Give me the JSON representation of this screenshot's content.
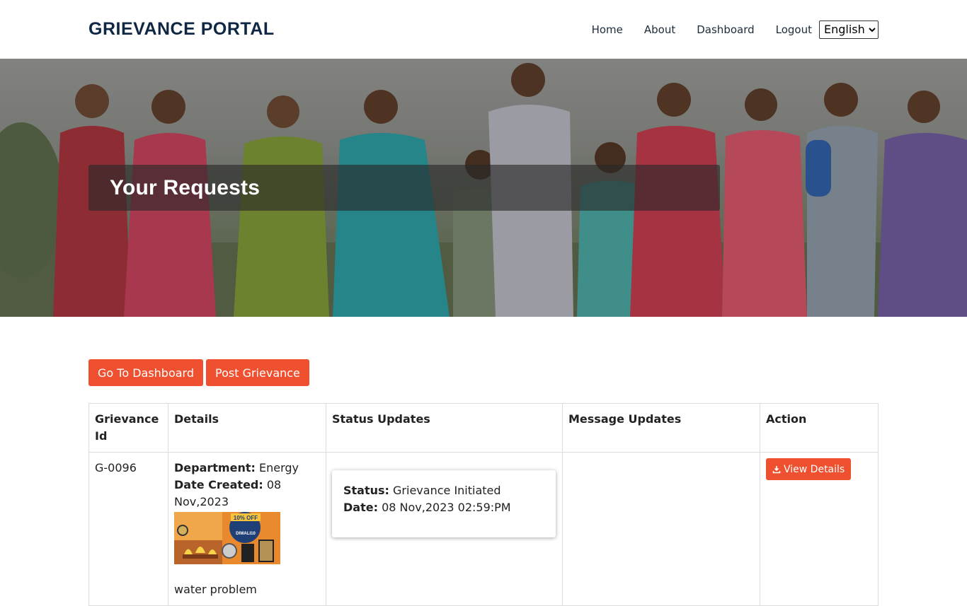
{
  "header": {
    "brand": "GRIEVANCE PORTAL",
    "nav": [
      "Home",
      "About",
      "Dashboard",
      "Logout"
    ],
    "language": "English"
  },
  "hero": {
    "title": "Your Requests"
  },
  "actions": {
    "dashboard_label": "Go To Dashboard",
    "post_label": "Post Grievance"
  },
  "table": {
    "headers": [
      "Grievance Id",
      "Details",
      "Status Updates",
      "Message Updates",
      "Action"
    ],
    "rows": [
      {
        "id": "G-0096",
        "department_label": "Department:",
        "department": "Energy",
        "date_created_label": "Date Created:",
        "date_created": "08 Nov,2023",
        "thumbnail_icon": "promo-image-icon",
        "thumbnail_text": "10% OFF",
        "thumbnail_code": "DIWALI10",
        "description": "water problem",
        "status_label": "Status:",
        "status": "Grievance Initiated",
        "status_date_label": "Date:",
        "status_date": "08 Nov,2023 02:59:PM",
        "message": "",
        "action_label": "View Details",
        "action_icon": "download-icon"
      }
    ]
  },
  "colors": {
    "accent": "#ef5030",
    "brand": "#0f2744"
  }
}
